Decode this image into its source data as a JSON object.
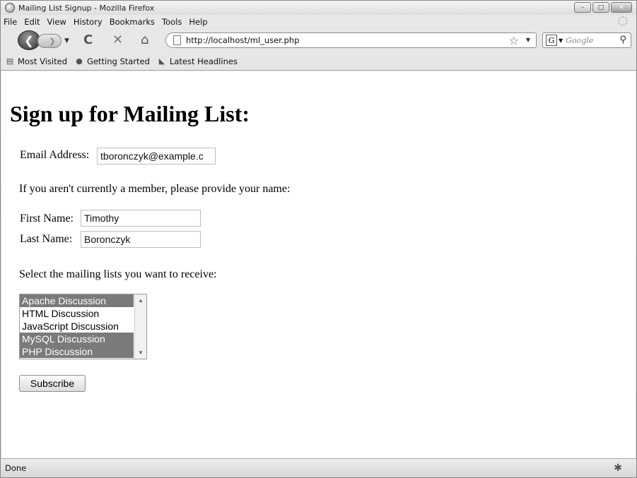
{
  "window": {
    "title": "Mailing List Signup - Mozilla Firefox",
    "controls": {
      "minimize": "–",
      "maximize": "□",
      "close": "✕"
    }
  },
  "menu": [
    {
      "label": "File"
    },
    {
      "label": "Edit"
    },
    {
      "label": "View"
    },
    {
      "label": "History"
    },
    {
      "label": "Bookmarks"
    },
    {
      "label": "Tools"
    },
    {
      "label": "Help"
    }
  ],
  "navigation": {
    "url": "http://localhost/ml_user.php",
    "search_placeholder": "Google",
    "search_engine_glyph": "G"
  },
  "bookmarks": [
    {
      "label": "Most Visited",
      "icon": "most-visited-icon"
    },
    {
      "label": "Getting Started",
      "icon": "firefox-icon"
    },
    {
      "label": "Latest Headlines",
      "icon": "rss-icon"
    }
  ],
  "page": {
    "heading": "Sign up for Mailing List:",
    "email_label": "Email Address:",
    "email_value": "tboronczyk@example.c",
    "member_prompt": "If you aren't currently a member, please provide your name:",
    "first_name_label": "First Name:",
    "first_name_value": "Timothy",
    "last_name_label": "Last Name:",
    "last_name_value": "Boronczyk",
    "lists_prompt": "Select the mailing lists you want to receive:",
    "lists": [
      {
        "label": "Apache Discussion",
        "selected": true
      },
      {
        "label": "HTML Discussion",
        "selected": false
      },
      {
        "label": "JavaScript Discussion",
        "selected": false
      },
      {
        "label": "MySQL Discussion",
        "selected": true
      },
      {
        "label": "PHP Discussion",
        "selected": true
      }
    ],
    "subscribe_label": "Subscribe"
  },
  "status": {
    "text": "Done"
  },
  "colors": {
    "selected_option_bg": "#7a7a7a",
    "content_bg": "#ffffff"
  }
}
